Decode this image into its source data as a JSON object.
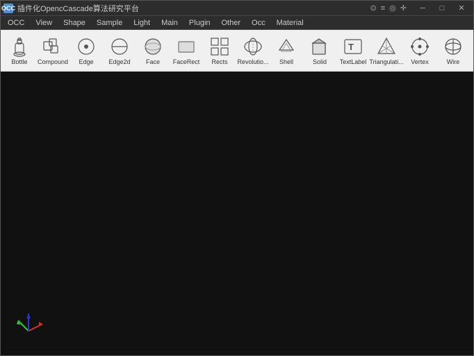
{
  "app": {
    "title": "插件化OpencCascade算法研究平台",
    "icon_text": "OCC"
  },
  "title_bar": {
    "controls": {
      "minimize": "─",
      "maximize": "□",
      "close": "✕"
    },
    "extra_icons": [
      "⊙",
      "≡",
      "◎",
      "+"
    ]
  },
  "menu": {
    "items": [
      {
        "id": "occ-menu",
        "label": "OCC"
      },
      {
        "id": "view-menu",
        "label": "View"
      },
      {
        "id": "shape-menu",
        "label": "Shape"
      },
      {
        "id": "sample-menu",
        "label": "Sample"
      },
      {
        "id": "light-menu",
        "label": "Light"
      },
      {
        "id": "main-menu",
        "label": "Main"
      },
      {
        "id": "plugin-menu",
        "label": "Plugin"
      },
      {
        "id": "other-menu",
        "label": "Other"
      },
      {
        "id": "occ2-menu",
        "label": "Occ"
      },
      {
        "id": "material-menu",
        "label": "Material"
      }
    ]
  },
  "toolbar": {
    "tools": [
      {
        "id": "bottle",
        "label": "Bottle",
        "icon_type": "bottle"
      },
      {
        "id": "compound",
        "label": "Compound",
        "icon_type": "compound"
      },
      {
        "id": "edge",
        "label": "Edge",
        "icon_type": "edge"
      },
      {
        "id": "edge2d",
        "label": "Edge2d",
        "icon_type": "edge2d"
      },
      {
        "id": "face",
        "label": "Face",
        "icon_type": "face"
      },
      {
        "id": "facerect",
        "label": "FaceRect",
        "icon_type": "facerect"
      },
      {
        "id": "rects",
        "label": "Rects",
        "icon_type": "rects"
      },
      {
        "id": "revolution",
        "label": "Revolutio...",
        "icon_type": "revolution"
      },
      {
        "id": "shell",
        "label": "Shell",
        "icon_type": "shell"
      },
      {
        "id": "solid",
        "label": "Solid",
        "icon_type": "solid"
      },
      {
        "id": "textlabel",
        "label": "TextLabel",
        "icon_type": "textlabel"
      },
      {
        "id": "triangulation",
        "label": "Triangulati...",
        "icon_type": "triangulation"
      },
      {
        "id": "vertex",
        "label": "Vertex",
        "icon_type": "vertex"
      },
      {
        "id": "wire",
        "label": "Wire",
        "icon_type": "wire"
      }
    ]
  },
  "viewport": {
    "background_color": "#111111"
  }
}
